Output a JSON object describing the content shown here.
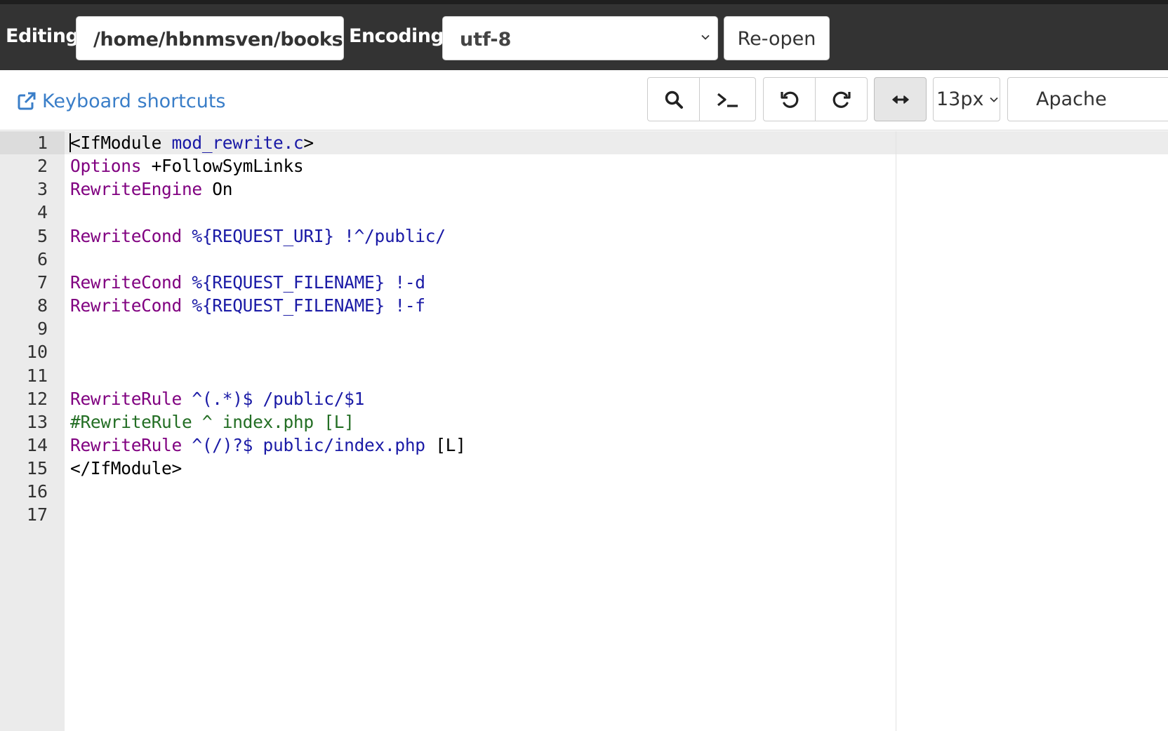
{
  "header": {
    "editing_label": "Editing:",
    "file_path": "/home/hbnmsven/books",
    "encoding_label": "Encoding:",
    "encoding_value": "utf-8",
    "reopen_label": "Re-open"
  },
  "toolbar": {
    "keyboard_shortcuts_label": "Keyboard shortcuts",
    "font_size": "13px",
    "mode": "Apache",
    "icons": [
      "external-link-icon",
      "search-icon",
      "terminal-icon",
      "undo-icon",
      "redo-icon",
      "wrap-arrows-icon",
      "chevron-down-icon"
    ]
  },
  "colors": {
    "keyword": "#800080",
    "variable": "#1a1aa6",
    "comment": "#236e24",
    "plain": "#000000",
    "link": "#3a7ec8",
    "topbar": "#333333"
  },
  "editor": {
    "active_line": 1,
    "lines": [
      {
        "n": "1",
        "tokens": [
          {
            "t": "<IfModule ",
            "c": "pl"
          },
          {
            "t": "mod_rewrite.c",
            "c": "var"
          },
          {
            "t": ">",
            "c": "pl"
          }
        ]
      },
      {
        "n": "2",
        "tokens": [
          {
            "t": "Options",
            "c": "kw"
          },
          {
            "t": " +FollowSymLinks",
            "c": "pl"
          }
        ]
      },
      {
        "n": "3",
        "tokens": [
          {
            "t": "RewriteEngine",
            "c": "kw"
          },
          {
            "t": " On",
            "c": "pl"
          }
        ]
      },
      {
        "n": "4",
        "tokens": []
      },
      {
        "n": "5",
        "tokens": [
          {
            "t": "RewriteCond",
            "c": "kw"
          },
          {
            "t": " %{REQUEST_URI} !^/public/",
            "c": "var"
          }
        ]
      },
      {
        "n": "6",
        "tokens": []
      },
      {
        "n": "7",
        "tokens": [
          {
            "t": "RewriteCond",
            "c": "kw"
          },
          {
            "t": " %{REQUEST_FILENAME} !-d",
            "c": "var"
          }
        ]
      },
      {
        "n": "8",
        "tokens": [
          {
            "t": "RewriteCond",
            "c": "kw"
          },
          {
            "t": " %{REQUEST_FILENAME} !-f",
            "c": "var"
          }
        ]
      },
      {
        "n": "9",
        "tokens": []
      },
      {
        "n": "10",
        "tokens": []
      },
      {
        "n": "11",
        "tokens": []
      },
      {
        "n": "12",
        "tokens": [
          {
            "t": "RewriteRule",
            "c": "kw"
          },
          {
            "t": " ^(.*)$ /public/$1",
            "c": "var"
          }
        ]
      },
      {
        "n": "13",
        "tokens": [
          {
            "t": "#RewriteRule ^ index.php [L]",
            "c": "cm"
          }
        ]
      },
      {
        "n": "14",
        "tokens": [
          {
            "t": "RewriteRule",
            "c": "kw"
          },
          {
            "t": " ^(/)?$ public/index.php",
            "c": "var"
          },
          {
            "t": " [L]",
            "c": "pl"
          }
        ]
      },
      {
        "n": "15",
        "tokens": [
          {
            "t": "</IfModule>",
            "c": "pl"
          }
        ]
      },
      {
        "n": "16",
        "tokens": []
      },
      {
        "n": "17",
        "tokens": []
      }
    ]
  }
}
